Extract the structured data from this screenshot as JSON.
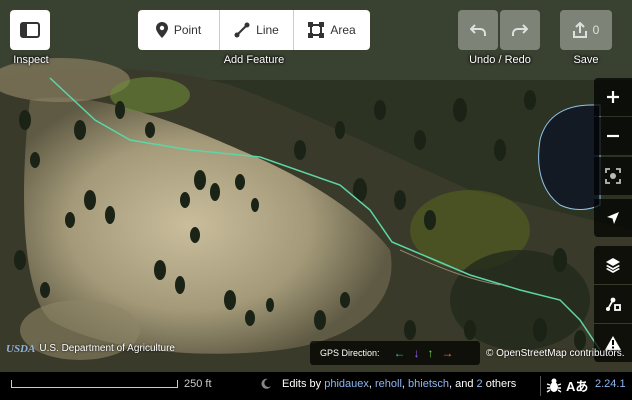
{
  "toolbar": {
    "inspect_label": "Inspect",
    "add_feature_label": "Add Feature",
    "modes": [
      {
        "label": "Point",
        "icon": "point-icon"
      },
      {
        "label": "Line",
        "icon": "line-icon"
      },
      {
        "label": "Area",
        "icon": "area-icon"
      }
    ],
    "undo_redo_label": "Undo / Redo",
    "save_label": "Save",
    "save_count": "0"
  },
  "map_controls": [
    "zoom-in-icon",
    "zoom-out-icon",
    "zoom-to-selection-icon",
    "geolocate-icon",
    "background-layers-icon",
    "map-data-icon",
    "issues-icon"
  ],
  "attribution": {
    "usda_logo": "USDA",
    "usda_text": "U.S. Department of Agriculture",
    "osm_text": "© OpenStreetMap contributors."
  },
  "gps": {
    "label": "GPS Direction:",
    "arrows": [
      {
        "glyph": "←",
        "color": "#19c6c6"
      },
      {
        "glyph": "↓",
        "color": "#9966ff"
      },
      {
        "glyph": "↑",
        "color": "#7bd34e"
      },
      {
        "glyph": "→",
        "color": "#ff6a3d"
      }
    ]
  },
  "footer": {
    "scale_label": "250 ft",
    "edits_prefix": "Edits by",
    "contributors": [
      "phidauex",
      "reholl",
      "bhietsch"
    ],
    "edits_and": "and",
    "others_count": "2",
    "others_label": "others",
    "version": "2.24.1"
  },
  "colors": {
    "link": "#8eb6f2",
    "trail": "#5cd6a6",
    "water_outline": "#8fc4e8"
  }
}
